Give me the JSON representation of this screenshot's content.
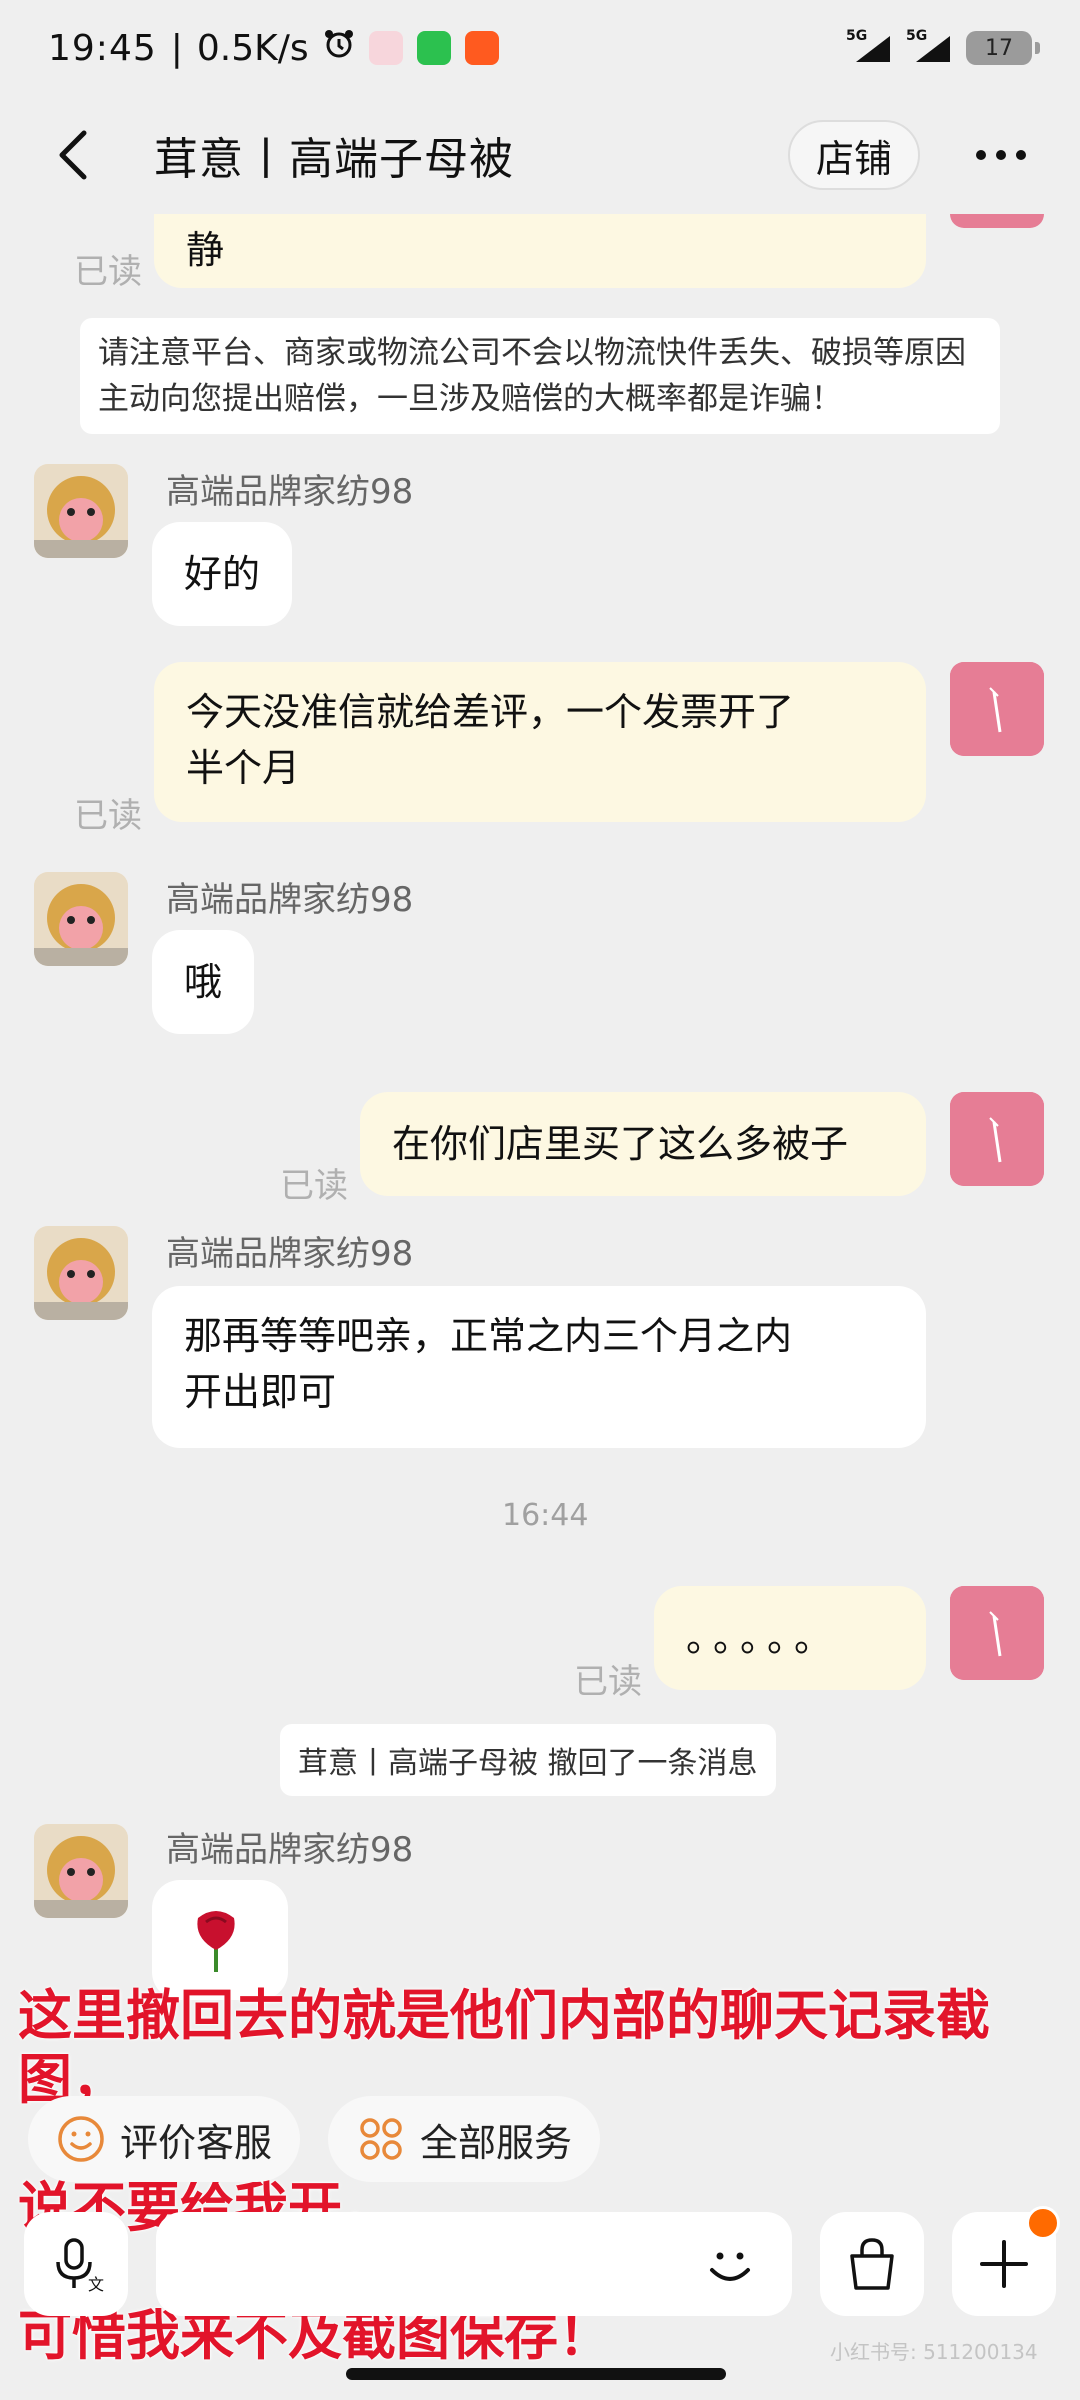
{
  "status_bar": {
    "time": "19:45",
    "speed": "0.5K/s",
    "network_1": "5G",
    "network_2": "5G",
    "battery": "17"
  },
  "header": {
    "title": "茸意丨高端子母被",
    "shop_button": "店铺"
  },
  "chat": {
    "top_partial_message": "静",
    "read_label": "已读",
    "notice": "请注意平台、商家或物流公司不会以物流快件丢失、破损等原因主动向您提出赔偿，一旦涉及赔偿的大概率都是诈骗！",
    "seller_name": "高端品牌家纺98",
    "msg_reply_1": "好的",
    "msg_out_1_line1": "今天没准信就给差评，一个发票开了",
    "msg_out_1_line2": "半个月",
    "msg_reply_2": "哦",
    "msg_out_2": "在你们店里买了这么多被子",
    "msg_reply_3_line1": "那再等等吧亲，正常之内三个月之内",
    "msg_reply_3_line2": "开出即可",
    "timestamp": "16:44",
    "msg_out_3": "。。。。。",
    "recall_notice": "茸意丨高端子母被 撤回了一条消息"
  },
  "annotation": {
    "line1": "这里撤回去的就是他们内部的聊天记录截图，",
    "line2": "说不要给我开，",
    "line3": "可惜我来不及截图保存！"
  },
  "quick_actions": {
    "rate_service": "评价客服",
    "all_services": "全部服务"
  },
  "input": {
    "placeholder": ""
  },
  "watermark": "小红书号: 511200134",
  "colors": {
    "accent_orange": "#ff6a00",
    "annotation_red": "#e2142a",
    "outgoing_bubble": "#fdf8e2",
    "incoming_bubble": "#ffffff",
    "quick_icon": "#e8893a"
  },
  "icons": {
    "back": "chevron-left-icon",
    "more": "more-dots-icon",
    "voice": "voice-input-icon",
    "emoji": "smiley-icon",
    "bag": "shopping-bag-icon",
    "plus": "plus-icon",
    "rate": "smiley-outline-icon",
    "services": "grid-circles-icon"
  }
}
